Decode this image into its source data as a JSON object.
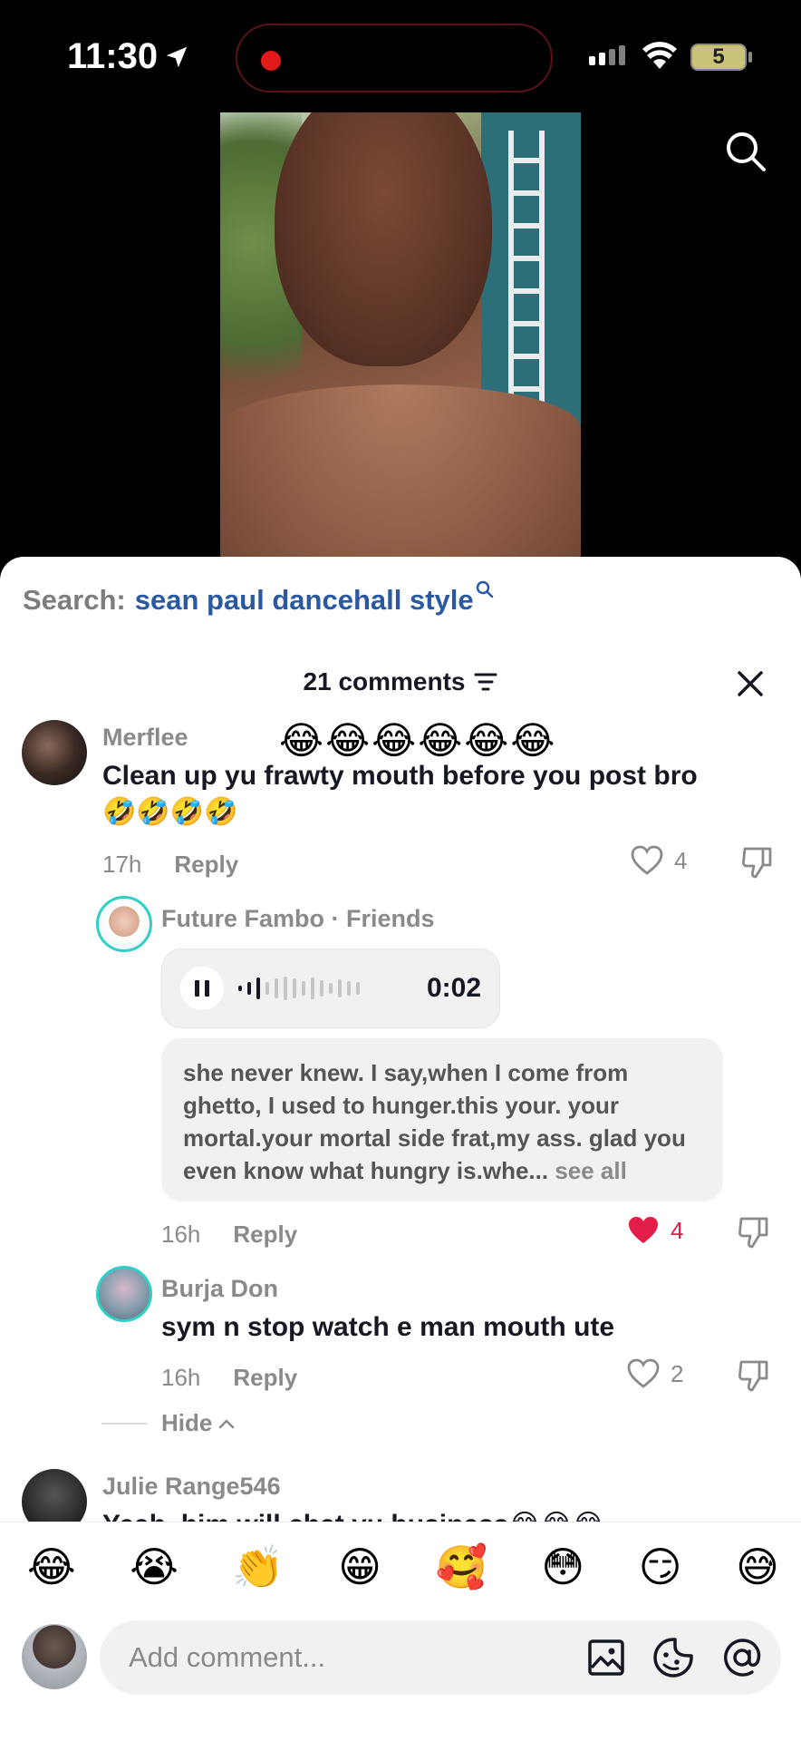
{
  "status_bar": {
    "time": "11:30",
    "battery": "5"
  },
  "sheet": {
    "search_label": "Search:",
    "search_term": "sean paul dancehall style",
    "comment_count": "21 comments"
  },
  "comments": [
    {
      "username": "Merflee",
      "floating_emojis": "😂😂😂😂😂😂",
      "text": "Clean up yu frawty mouth before you post bro",
      "emojis": "🤣🤣🤣🤣",
      "time": "17h",
      "reply_label": "Reply",
      "likes": "4"
    },
    {
      "username": "Future Fambo",
      "badge": "· Friends",
      "voice_duration": "0:02",
      "transcript": "she never knew. I say,when I come from ghetto, I used to hunger.this your. your mortal.your mortal side frat,my ass. glad you even know what hungry is.whe...",
      "see_all": "see all",
      "time": "16h",
      "reply_label": "Reply",
      "likes": "4"
    },
    {
      "username": "Burja Don",
      "text": "sym n stop watch e man mouth ute",
      "time": "16h",
      "reply_label": "Reply",
      "likes": "2"
    },
    {
      "username": "Julie Range546",
      "text": "Yeah, him will chat yu business😂😂😂"
    }
  ],
  "hide_label": "Hide",
  "emoji_bar": [
    "😂",
    "😭",
    "👏",
    "😁",
    "🥰",
    "😳",
    "😏",
    "😅"
  ],
  "input": {
    "placeholder": "Add comment..."
  },
  "colors": {
    "accent_blue": "#2a59a1",
    "like_red": "#e11d48",
    "text_primary": "#161823",
    "text_secondary": "#8a8a8a"
  }
}
